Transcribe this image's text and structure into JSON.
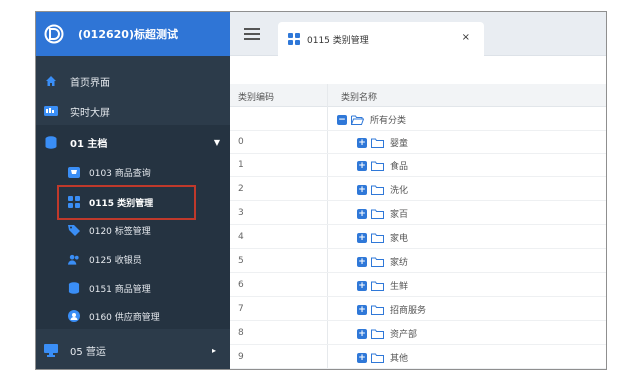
{
  "app": {
    "brand_title": "(012620)标超测试"
  },
  "colors": {
    "brand_bar": "#2f75d6",
    "sidebar_bg": "#2c3b4a",
    "highlight_box": "#c0392b",
    "tree_icon": "#2f78d8"
  },
  "sidebar": {
    "items": [
      {
        "icon": "home-icon",
        "label": "首页界面"
      },
      {
        "icon": "data-screen-icon",
        "label": "实时大屏"
      },
      {
        "icon": "database-icon",
        "label": "01 主档",
        "expanded": true
      },
      {
        "icon": "cart-icon",
        "label": "0103 商品查询"
      },
      {
        "icon": "grid-icon",
        "label": "0115 类别管理",
        "selected": true
      },
      {
        "icon": "tag-icon",
        "label": "0120 标签管理"
      },
      {
        "icon": "users-icon",
        "label": "0125 收银员"
      },
      {
        "icon": "database-icon",
        "label": "0151 商品管理"
      },
      {
        "icon": "supplier-icon",
        "label": "0160 供应商管理"
      },
      {
        "icon": "monitor-icon",
        "label": "05 营运",
        "expanded": false
      }
    ]
  },
  "tabs": [
    {
      "icon": "grid-icon",
      "label": "0115 类别管理",
      "close": "×"
    }
  ],
  "table": {
    "headers": [
      "类别编码",
      "类别名称"
    ],
    "root": {
      "code": "",
      "name": "所有分类"
    },
    "rows": [
      {
        "code": "0",
        "name": "婴童"
      },
      {
        "code": "1",
        "name": "食品"
      },
      {
        "code": "2",
        "name": "洗化"
      },
      {
        "code": "3",
        "name": "家百"
      },
      {
        "code": "4",
        "name": "家电"
      },
      {
        "code": "5",
        "name": "家纺"
      },
      {
        "code": "6",
        "name": "生鲜"
      },
      {
        "code": "7",
        "name": "招商服务"
      },
      {
        "code": "8",
        "name": "资产部"
      },
      {
        "code": "9",
        "name": "其他"
      }
    ]
  }
}
